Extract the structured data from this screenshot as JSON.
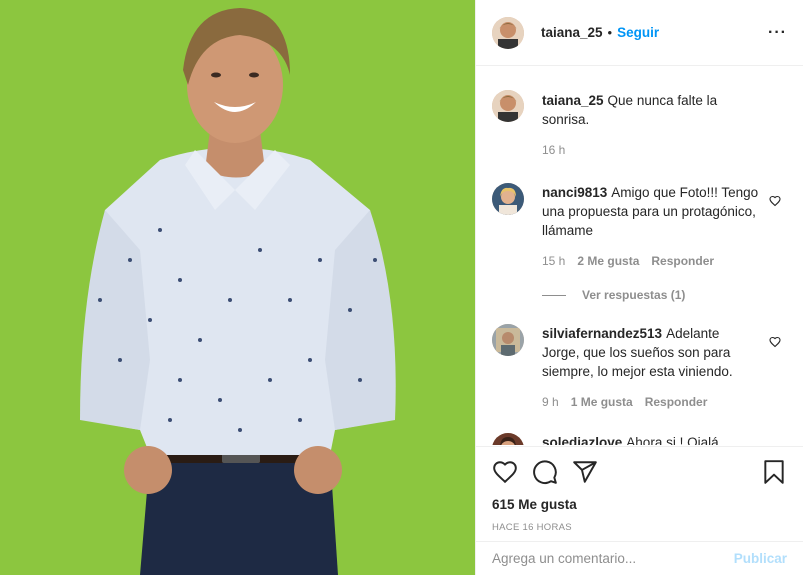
{
  "post_author": {
    "username": "taiana_25",
    "follow_label": "Seguir",
    "separator": "•"
  },
  "caption": {
    "username": "taiana_25",
    "text": "Que nunca falte la sonrisa.",
    "time": "16 h"
  },
  "comments": [
    {
      "username": "nanci9813",
      "text": "Amigo que Foto!!! Tengo una propuesta para un protagónico, llámame",
      "time": "15 h",
      "likes": "2 Me gusta",
      "reply_label": "Responder",
      "view_replies": "Ver respuestas (1)"
    },
    {
      "username": "silviafernandez513",
      "text": "Adelante Jorge, que los sueños son para siempre, lo mejor esta viniendo.",
      "time": "9 h",
      "likes": "1 Me gusta",
      "reply_label": "Responder"
    },
    {
      "username": "solediazlove",
      "text": "Ahora si ! Ojalá encuentres una chica joven y"
    }
  ],
  "likes_count": "615 Me gusta",
  "post_time": "HACE 16 HORAS",
  "add_comment": {
    "placeholder": "Agrega un comentario...",
    "publish_label": "Publicar"
  },
  "icons": {
    "like": "heart-icon",
    "comment": "comment-icon",
    "share": "share-icon",
    "save": "bookmark-icon",
    "more": "more-options-icon"
  },
  "colors": {
    "background_green": "#8cc63f",
    "link_blue": "#0095f6",
    "publish_disabled": "#b2dffc",
    "muted": "#8e8e8e"
  }
}
